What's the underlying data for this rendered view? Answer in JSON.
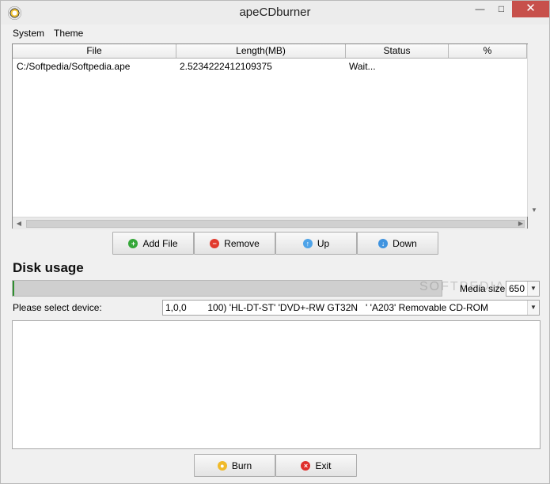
{
  "window": {
    "title": "apeCDburner",
    "controls": {
      "minimize": "—",
      "maximize": "□",
      "close": "✕"
    }
  },
  "menu": [
    "System",
    "Theme"
  ],
  "table": {
    "headers": [
      "File",
      "Length(MB)",
      "Status",
      "%"
    ],
    "rows": [
      [
        "C:/Softpedia/Softpedia.ape",
        "2.5234222412109375",
        "Wait...",
        ""
      ]
    ]
  },
  "buttons": {
    "add": "Add File",
    "remove": "Remove",
    "up": "Up",
    "down": "Down",
    "burn": "Burn",
    "exit": "Exit"
  },
  "disk": {
    "label": "Disk usage",
    "usage_fraction": 0.004,
    "media_label": "Media size:",
    "media_value": "650",
    "device_label": "Please select device:",
    "device_value": "1,0,0        100) 'HL-DT-ST' 'DVD+-RW GT32N   ' 'A203' Removable CD-ROM"
  },
  "watermark": "SOFTPEDIA",
  "colors": {
    "close_button": "#c7504b",
    "usage_fill": "#2f8f2f",
    "add_icon": "#35a739",
    "remove_icon": "#e13a2d",
    "up_icon": "#4ea3e8",
    "burn_icon": "#f0ba2a"
  },
  "icons": {
    "app": "disc-icon",
    "add": "plus-icon",
    "remove": "minus-icon",
    "up": "up-arrow-icon",
    "down": "down-arrow-icon",
    "burn": "burn-disc-icon",
    "exit": "stop-icon"
  }
}
